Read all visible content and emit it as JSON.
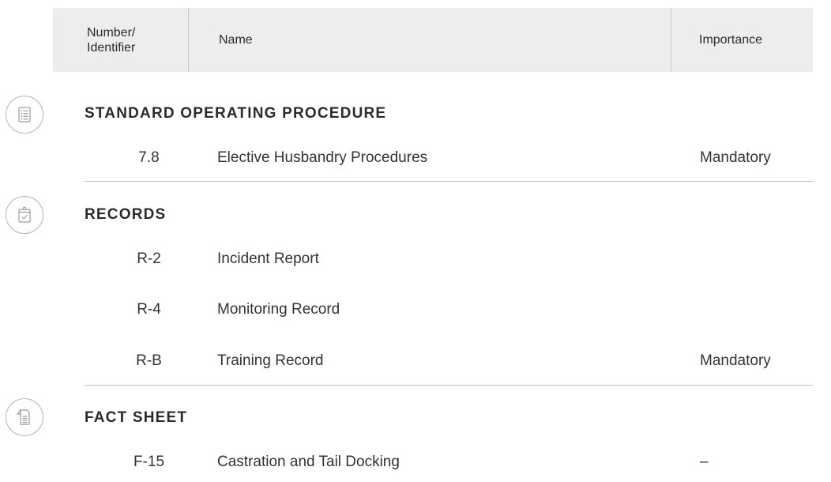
{
  "header": {
    "id_label": "Number/\nIdentifier",
    "name_label": "Name",
    "importance_label": "Importance"
  },
  "sections": [
    {
      "title": "STANDARD OPERATING PROCEDURE",
      "icon": "checklist-icon",
      "rows": [
        {
          "id": "7.8",
          "name": "Elective Husbandry Procedures",
          "importance": "Mandatory"
        }
      ]
    },
    {
      "title": "RECORDS",
      "icon": "clipboard-check-icon",
      "rows": [
        {
          "id": "R-2",
          "name": "Incident Report",
          "importance": ""
        },
        {
          "id": "R-4",
          "name": "Monitoring Record",
          "importance": ""
        },
        {
          "id": "R-B",
          "name": "Training Record",
          "importance": "Mandatory"
        }
      ]
    },
    {
      "title": "FACT SHEET",
      "icon": "document-icon",
      "rows": [
        {
          "id": "F-15",
          "name": "Castration and Tail Docking",
          "importance": "–"
        }
      ]
    }
  ]
}
